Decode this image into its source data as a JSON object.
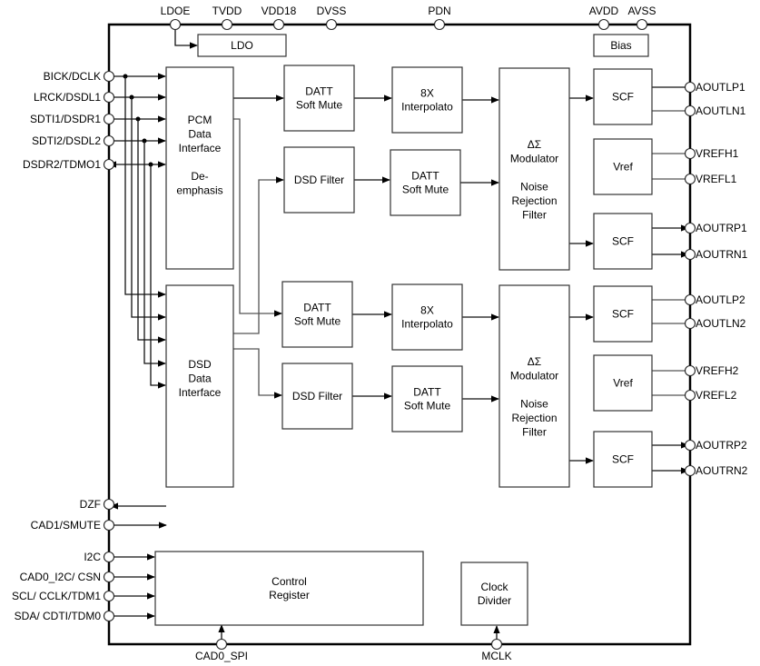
{
  "top_pins": [
    {
      "id": "ldoe",
      "label": "LDOE"
    },
    {
      "id": "tvdd",
      "label": "TVDD"
    },
    {
      "id": "vdd18",
      "label": "VDD18"
    },
    {
      "id": "dvss",
      "label": "DVSS"
    },
    {
      "id": "pdn",
      "label": "PDN"
    },
    {
      "id": "avdd",
      "label": "AVDD"
    },
    {
      "id": "avss",
      "label": "AVSS"
    }
  ],
  "left_pins": [
    {
      "id": "bick",
      "label": "BICK/DCLK"
    },
    {
      "id": "lrck",
      "label": "LRCK/DSDL1"
    },
    {
      "id": "sdti1",
      "label": "SDTI1/DSDR1"
    },
    {
      "id": "sdti2",
      "label": "SDTI2/DSDL2"
    },
    {
      "id": "dsdr2",
      "label": "DSDR2/TDMO1"
    },
    {
      "id": "dzf",
      "label": "DZF"
    },
    {
      "id": "cad1",
      "label": "CAD1/SMUTE"
    },
    {
      "id": "i2c",
      "label": "I2C"
    },
    {
      "id": "cad0i2c",
      "label": "CAD0_I2C/ CSN"
    },
    {
      "id": "scl",
      "label": "SCL/ CCLK/TDM1"
    },
    {
      "id": "sda",
      "label": "SDA/ CDTI/TDM0"
    }
  ],
  "right_pins": [
    {
      "id": "aoutlp1",
      "label": "AOUTLP1"
    },
    {
      "id": "aoutln1",
      "label": "AOUTLN1"
    },
    {
      "id": "vrefh1",
      "label": "VREFH1"
    },
    {
      "id": "vrefl1",
      "label": "VREFL1"
    },
    {
      "id": "aoutrp1",
      "label": "AOUTRP1"
    },
    {
      "id": "aoutrn1",
      "label": "AOUTRN1"
    },
    {
      "id": "aoutlp2",
      "label": "AOUTLP2"
    },
    {
      "id": "aoutln2",
      "label": "AOUTLN2"
    },
    {
      "id": "vrefh2",
      "label": "VREFH2"
    },
    {
      "id": "vrefl2",
      "label": "VREFL2"
    },
    {
      "id": "aoutrp2",
      "label": "AOUTRP2"
    },
    {
      "id": "aoutrn2",
      "label": "AOUTRN2"
    }
  ],
  "bottom_pins": [
    {
      "id": "cad0spi",
      "label": "CAD0_SPI"
    },
    {
      "id": "mclk",
      "label": "MCLK"
    }
  ],
  "blocks": {
    "ldo": [
      "LDO"
    ],
    "bias": [
      "Bias"
    ],
    "pcm": [
      "PCM",
      "Data",
      "Interface",
      "",
      "De-",
      "emphasis"
    ],
    "dsd": [
      "DSD",
      "Data",
      "Interface"
    ],
    "datt1": [
      "DATT",
      "Soft Mute"
    ],
    "interp1": [
      "8X",
      "Interpolato"
    ],
    "dsdfilt1": [
      "DSD Filter"
    ],
    "datt2": [
      "DATT",
      "Soft Mute"
    ],
    "mod1": [
      "ΔΣ",
      "Modulator",
      "",
      "Noise",
      "Rejection",
      "Filter"
    ],
    "scf1": [
      "SCF"
    ],
    "vref1": [
      "Vref"
    ],
    "scf2": [
      "SCF"
    ],
    "datt3": [
      "DATT",
      "Soft Mute"
    ],
    "interp2": [
      "8X",
      "Interpolato"
    ],
    "dsdfilt2": [
      "DSD Filter"
    ],
    "datt4": [
      "DATT",
      "Soft Mute"
    ],
    "mod2": [
      "ΔΣ",
      "Modulator",
      "",
      "Noise",
      "Rejection",
      "Filter"
    ],
    "scf3": [
      "SCF"
    ],
    "vref2": [
      "Vref"
    ],
    "scf4": [
      "SCF"
    ],
    "ctrl": [
      "Control",
      "Register"
    ],
    "clkdiv": [
      "Clock",
      "Divider"
    ]
  }
}
